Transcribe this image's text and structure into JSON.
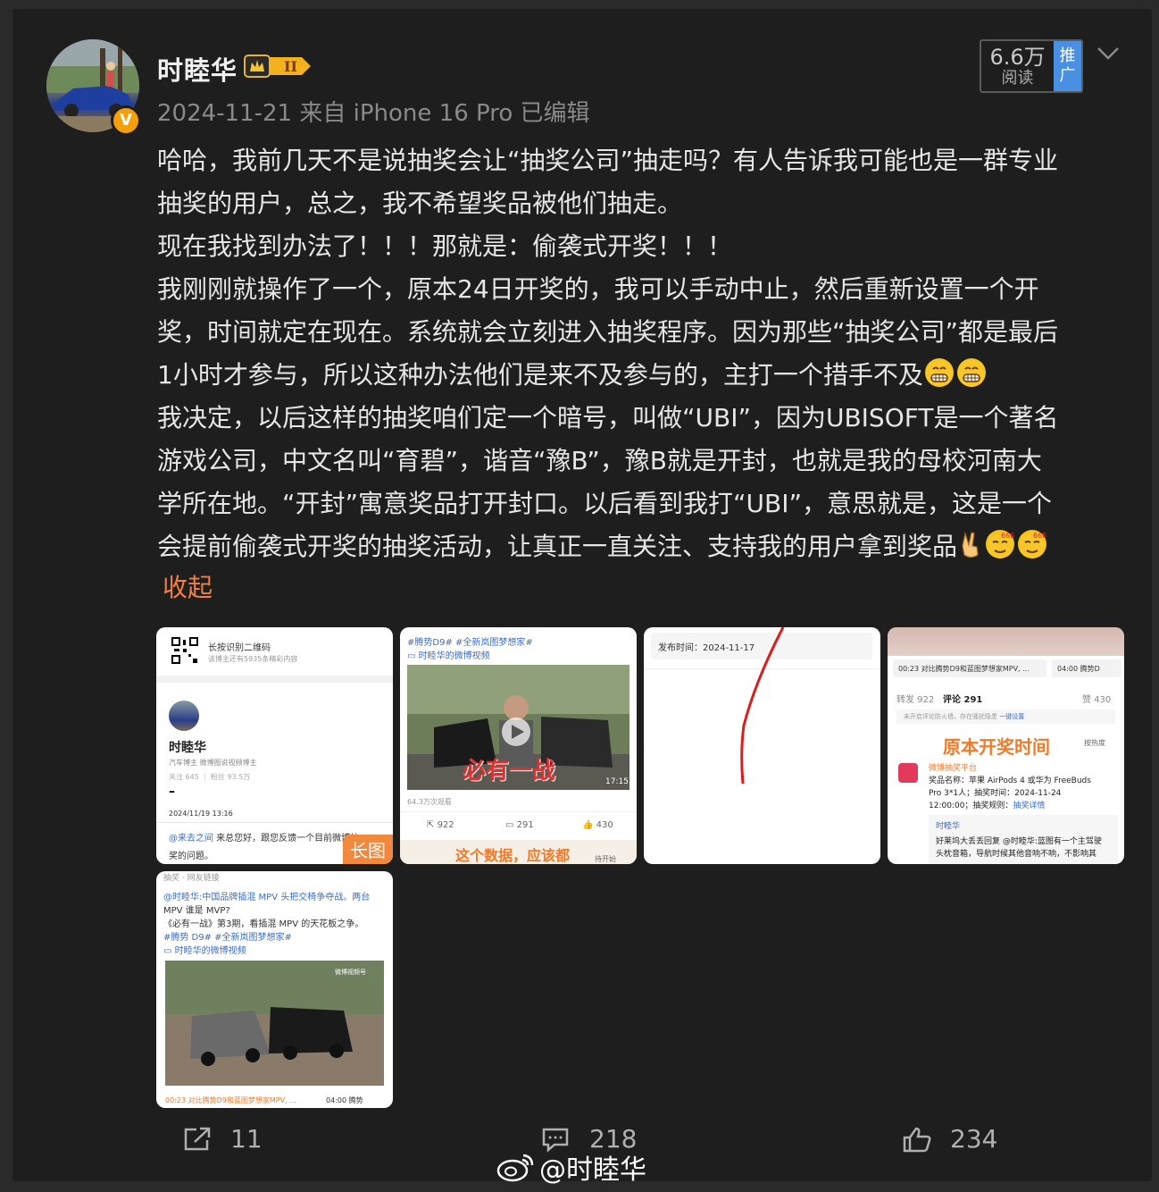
{
  "post": {
    "author": "时睦华",
    "vip_level": "II",
    "verified_mark": "V",
    "date": "2024-11-21",
    "source": "来自 iPhone 16 Pro",
    "edited": "已编辑",
    "reads_count": "6.6万",
    "reads_label": "阅读",
    "promote_label": "推广",
    "content_lines": [
      "哈哈，我前几天不是说抽奖会让“抽奖公司”抽走吗？有人告诉我可能也是一群专业",
      "抽奖的用户，总之，我不希望奖品被他们抽走。",
      "现在我找到办法了！！！那就是：偷袭式开奖！！！",
      "我刚刚就操作了一个，原本24日开奖的，我可以手动中止，然后重新设置一个开",
      "奖，时间就定在现在。系统就会立刻进入抽奖程序。因为那些“抽奖公司”都是最后",
      "1小时才参与，所以这种办法他们是来不及参与的，主打一个措手不及",
      "我决定，以后这样的抽奖咱们定一个暗号，叫做“UBI”，因为UBISOFT是一个著名",
      "游戏公司，中文名叫“育碧”，谐音“豫B”，豫B就是开封，也就是我的母校河南大",
      "学所在地。“开封”寓意奖品打开封口。以后看到我打“UBI”，意思就是，这是一个",
      "会提前偷袭式开奖的抽奖活动，让真正一直关注、支持我的用户拿到奖品"
    ],
    "collapse_label": "收起"
  },
  "emoji": {
    "grin": "grin-emoji",
    "victory": "victory-hand-emoji",
    "thinking666": "666-emoji"
  },
  "images": {
    "img1": {
      "qr_text": "长按识别二维码",
      "qr_sub": "该博主还有5935条精彩内容",
      "name": "时睦华",
      "desc": "汽车博主 微博图说视频博主",
      "stats": "关注 645 ｜ 粉丝 93.5万",
      "dash": "–",
      "time": "2024/11/19 13:16",
      "mention": "@来去之间",
      "body1": " 来总您好，跟您反馈一个目前微博抽",
      "body2": "奖的问题。",
      "long_tag": "长图"
    },
    "img2": {
      "top": "#腾势D9# #全新岚图梦想家#",
      "link": "时睦华的微博视频",
      "overlay": "必有一战",
      "duration": "17:15",
      "views": "64.3万次观看",
      "repost": "922",
      "comment": "291",
      "like": "430",
      "banner": "这个数据，应该都",
      "tag": "待开始"
    },
    "img3": {
      "publish": "发布时间：2024-11-17"
    },
    "img4": {
      "video1": "00:23 对比腾势D9和蓝图梦想家MPV, ...",
      "video2": "04:00 腾势D",
      "reposts": "转发 922",
      "comments": "评论 291",
      "likes": "赞 430",
      "notice": "未开启评论防火墙，存在骚扰隐患",
      "notice_link": "一键设置",
      "title": "原本开奖时间",
      "sort": "按热度",
      "platform": "微博抽奖平台",
      "prize1": "奖品名称：苹果 AirPods 4 或华为 FreeBuds",
      "prize2": "Pro 3*1人；抽奖时间：2024-11-24",
      "prize3": "12:00:00；抽奖规则：",
      "rule_link": "抽奖详情",
      "reply_name": "时睦华",
      "reply_line1": "好莱坞大丢丢回复 @时睦华:蓝图有一个主驾驶",
      "reply_line2": "头枕音箱，导航时候其他音响不响，不影响其"
    },
    "img5": {
      "header": "抽奖 · 网友链接",
      "line1": "@时睦华:中国品牌插混 MPV 头把交椅争夺战。两台",
      "line2": "MPV 谁是 MVP?",
      "line3": "《必有一战》第3期，看插混 MPV 的天花板之争。",
      "tags": "#腾势 D9# #全新岚图梦想家#",
      "link": "时睦华的微博视频",
      "watermark": "微博视频号",
      "v1": "00:23 对比腾势D9和蓝图梦想家MPV, ...",
      "v2": "04:00 腾势"
    }
  },
  "actions": {
    "repost_count": "11",
    "comment_count": "218",
    "like_count": "234"
  },
  "watermark": {
    "text": "@时睦华"
  }
}
